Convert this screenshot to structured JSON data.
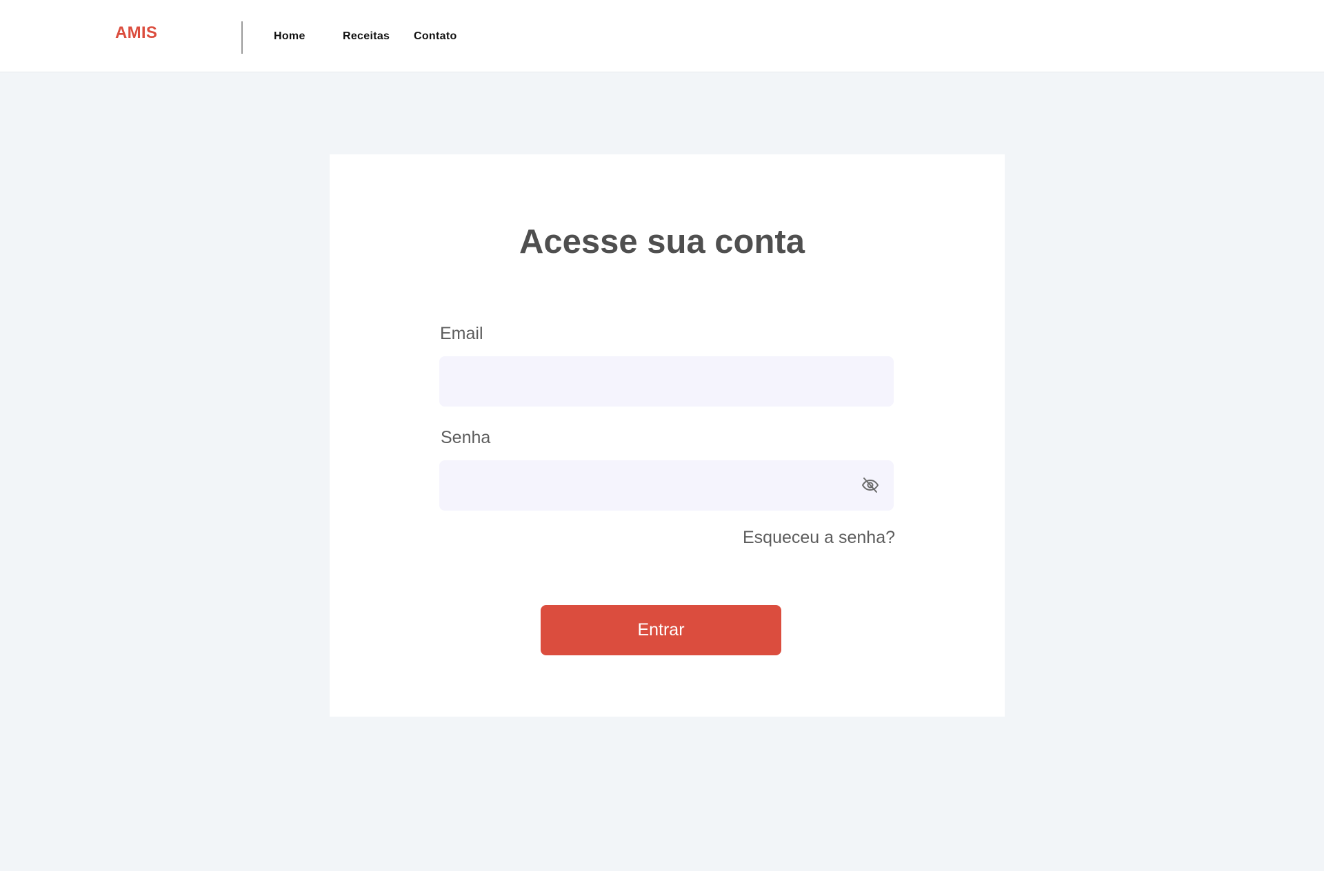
{
  "header": {
    "logo": "AMIS",
    "nav": [
      {
        "label": "Home"
      },
      {
        "label": "Receitas"
      },
      {
        "label": "Contato"
      }
    ]
  },
  "login": {
    "title": "Acesse sua conta",
    "email_label": "Email",
    "email_value": "",
    "email_placeholder": "",
    "password_label": "Senha",
    "password_value": "",
    "password_placeholder": "",
    "password_toggle_icon": "eye-off-icon",
    "forgot_password": "Esqueceu a senha?",
    "submit": "Entrar"
  },
  "colors": {
    "brand": "#db4d3e",
    "page_background": "#f2f5f8",
    "input_background": "#f5f4fd",
    "text_muted": "#5c5c5c",
    "title_text": "#4f4f4f"
  }
}
